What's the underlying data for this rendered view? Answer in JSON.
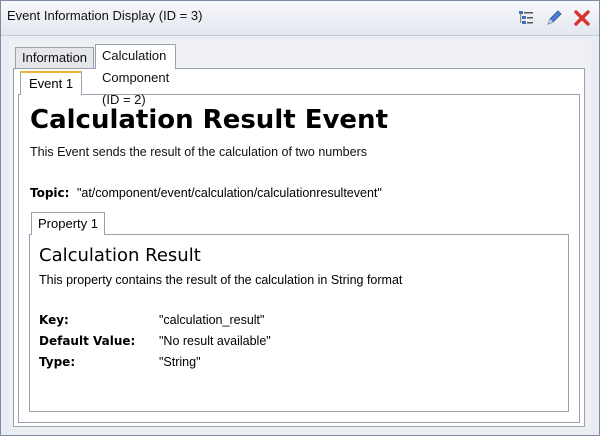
{
  "window": {
    "title": "Event Information Display (ID = 3)",
    "icons": [
      "tree-view-icon",
      "edit-pen-icon",
      "close-icon"
    ]
  },
  "outer_tabs": [
    {
      "label": "Information",
      "active": false
    },
    {
      "label": "Calculation Component (ID = 2)",
      "active": true
    }
  ],
  "event_tab": {
    "label": "Event 1"
  },
  "event": {
    "title": "Calculation Result Event",
    "description": "This Event sends the result of the calculation of two numbers",
    "topic_label": "Topic:",
    "topic_value": "\"at/component/event/calculation/calculationresultevent\""
  },
  "property_tab": {
    "label": "Property 1"
  },
  "property": {
    "title": "Calculation Result",
    "description": "This property contains the result of the calculation in String format",
    "key_label": "Key:",
    "key_value": "\"calculation_result\"",
    "default_label": "Default Value:",
    "default_value": "\"No result available\"",
    "type_label": "Type:",
    "type_value": "\"String\""
  },
  "colors": {
    "active_tab_accent": "#f0b33b",
    "close_icon": "#d9322b",
    "edit_icon": "#4a7fd0"
  }
}
